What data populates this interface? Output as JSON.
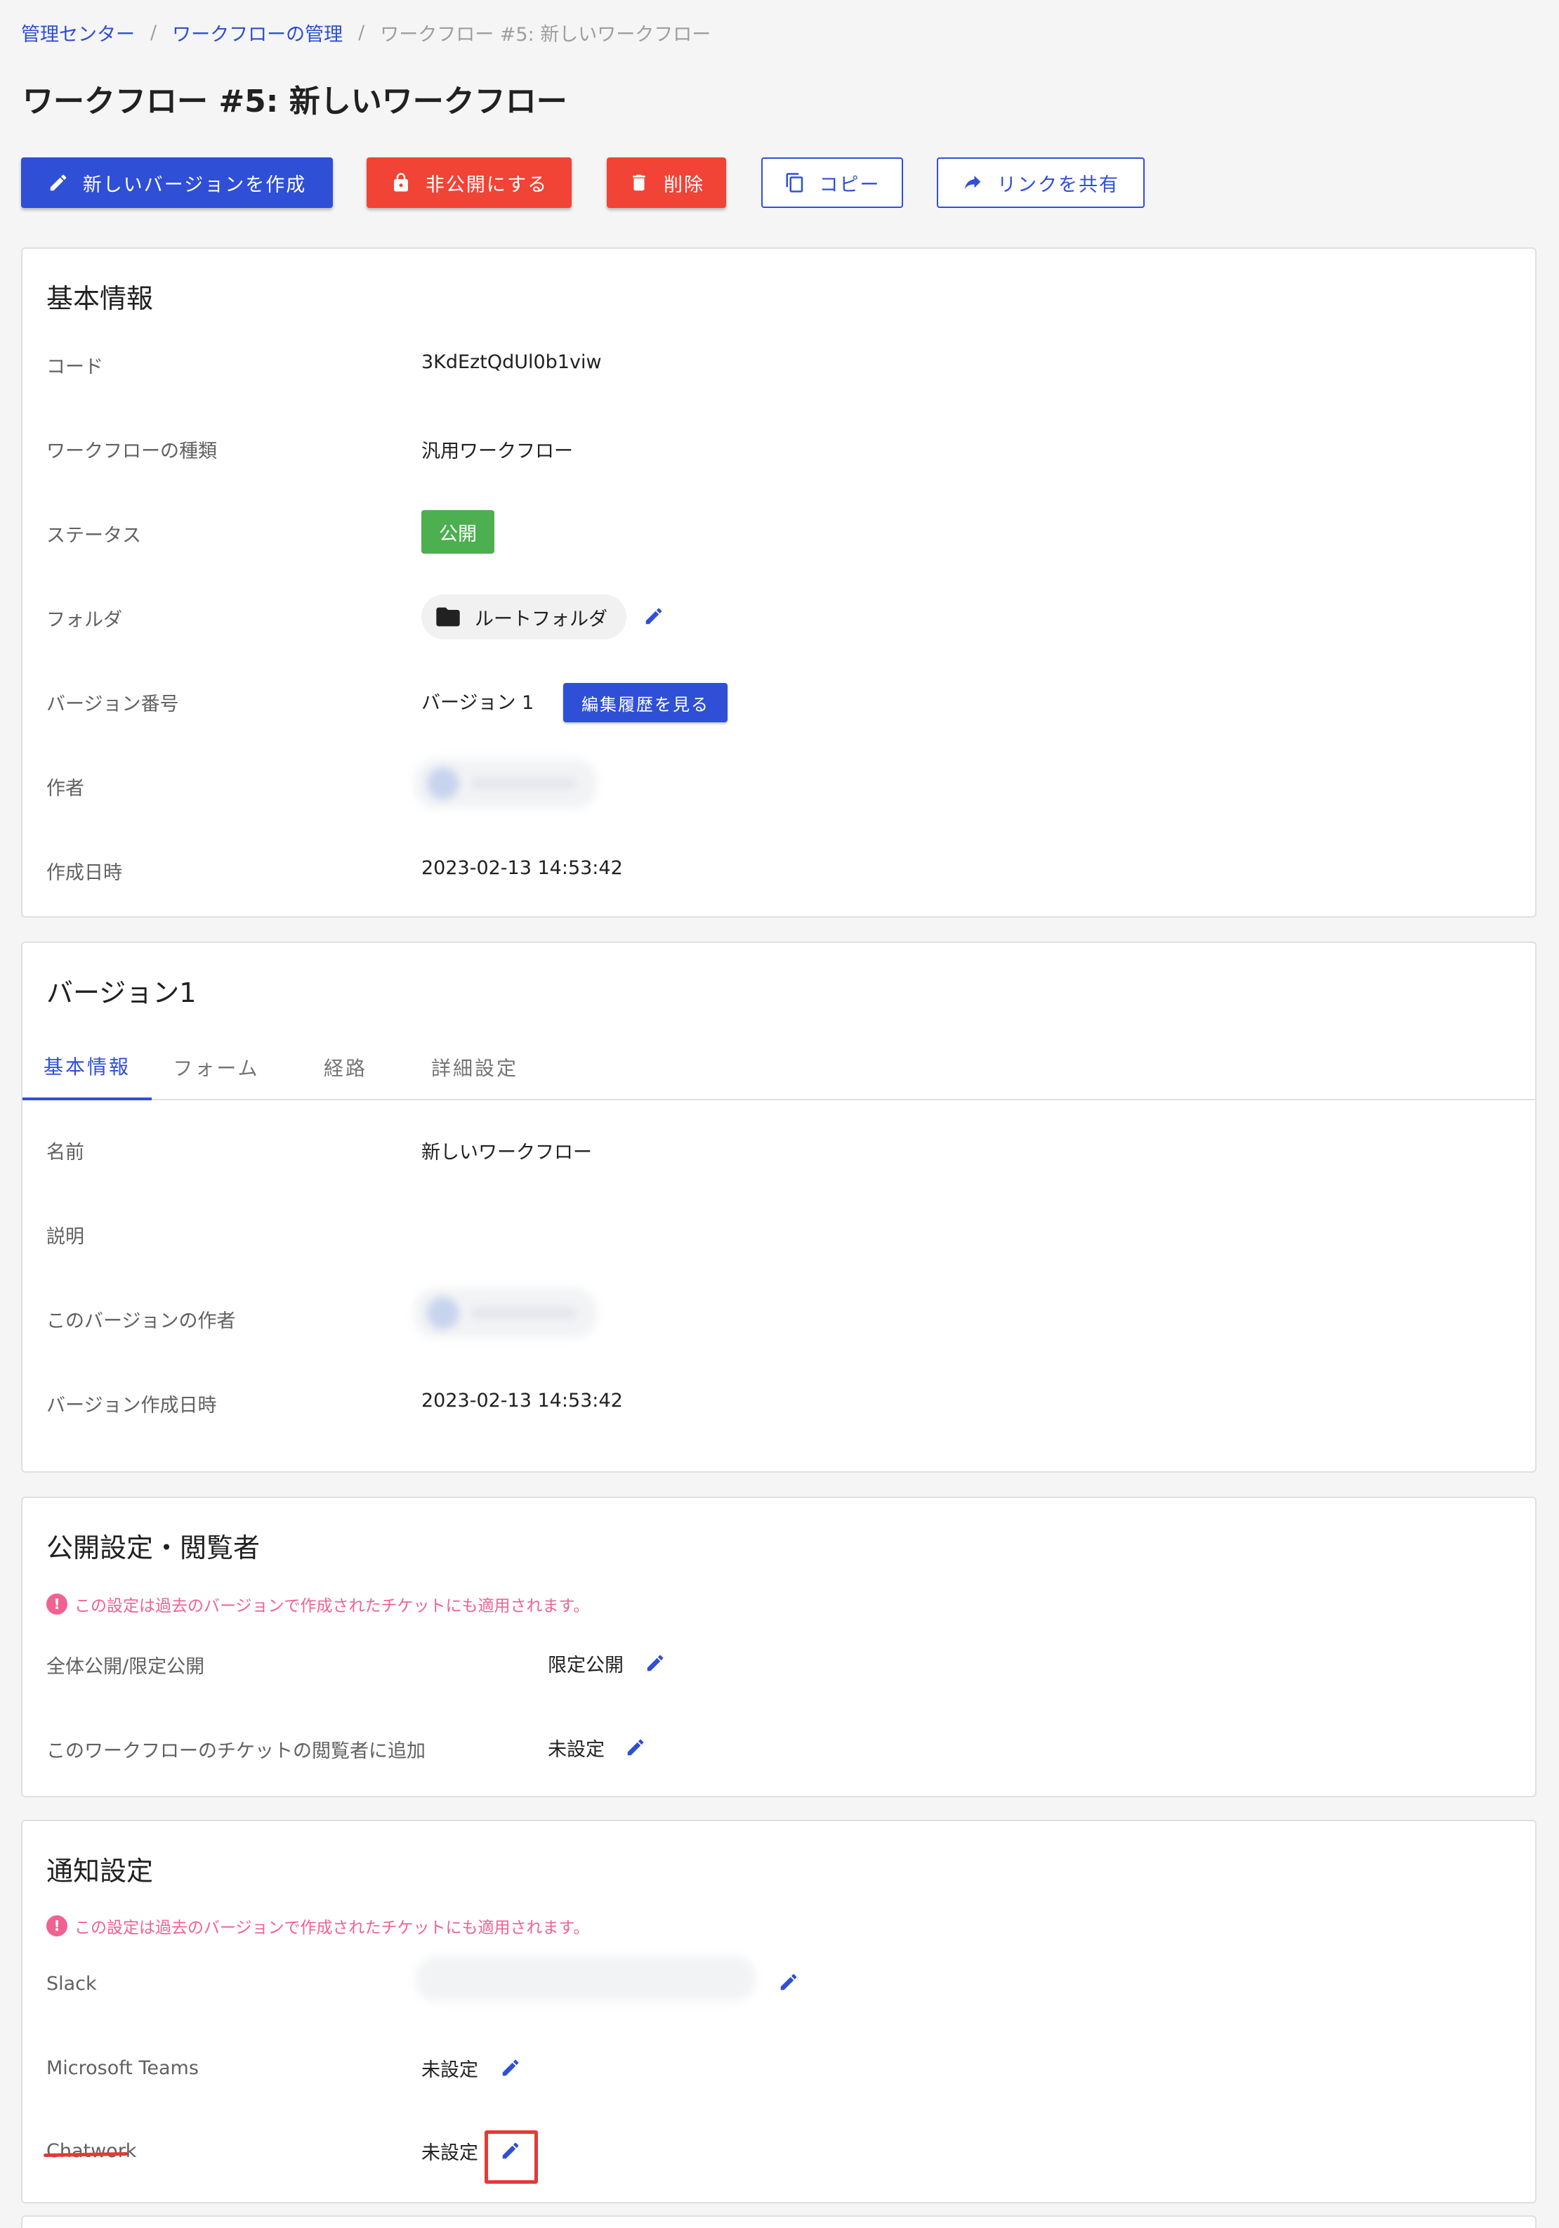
{
  "breadcrumb": {
    "items": [
      "管理センター",
      "ワークフローの管理"
    ],
    "separator": "/",
    "current": "ワークフロー #5: 新しいワークフロー"
  },
  "page_title": "ワークフロー #5: 新しいワークフロー",
  "toolbar": {
    "new_version": "新しいバージョンを作成",
    "unpublish": "非公開にする",
    "delete": "削除",
    "copy": "コピー",
    "share_link": "リンクを共有"
  },
  "basic_info": {
    "title": "基本情報",
    "code_label": "コード",
    "code_value": "3KdEztQdUl0b1viw",
    "type_label": "ワークフローの種類",
    "type_value": "汎用ワークフロー",
    "status_label": "ステータス",
    "status_value": "公開",
    "folder_label": "フォルダ",
    "folder_value": "ルートフォルダ",
    "version_label": "バージョン番号",
    "version_value": "バージョン 1",
    "history_button": "編集履歴を見る",
    "author_label": "作者",
    "created_label": "作成日時",
    "created_value": "2023-02-13 14:53:42"
  },
  "version": {
    "title": "バージョン1",
    "tabs": [
      "基本情報",
      "フォーム",
      "経路",
      "詳細設定"
    ],
    "name_label": "名前",
    "name_value": "新しいワークフロー",
    "desc_label": "説明",
    "author_label": "このバージョンの作者",
    "created_label": "バージョン作成日時",
    "created_value": "2023-02-13 14:53:42"
  },
  "visibility": {
    "title": "公開設定・閲覧者",
    "warning": "この設定は過去のバージョンで作成されたチケットにも適用されます。",
    "scope_label": "全体公開/限定公開",
    "scope_value": "限定公開",
    "viewers_label": "このワークフローのチケットの閲覧者に追加",
    "viewers_value": "未設定"
  },
  "notifications": {
    "title": "通知設定",
    "warning": "この設定は過去のバージョンで作成されたチケットにも適用されます。",
    "slack_label": "Slack",
    "teams_label": "Microsoft Teams",
    "teams_value": "未設定",
    "chatwork_label": "Chatwork",
    "chatwork_value": "未設定"
  },
  "colors": {
    "primary": "#2f4fd6",
    "danger": "#f14336",
    "success": "#4caf50",
    "warning_text": "#f06292",
    "highlight": "#e53935"
  },
  "icons": {
    "new_version": "pencil-icon",
    "unpublish": "lock-icon",
    "delete": "trash-icon",
    "copy": "copy-icon",
    "share": "share-arrow-icon",
    "folder": "folder-icon",
    "edit": "pencil-icon",
    "warning": "alert-circle-icon"
  }
}
